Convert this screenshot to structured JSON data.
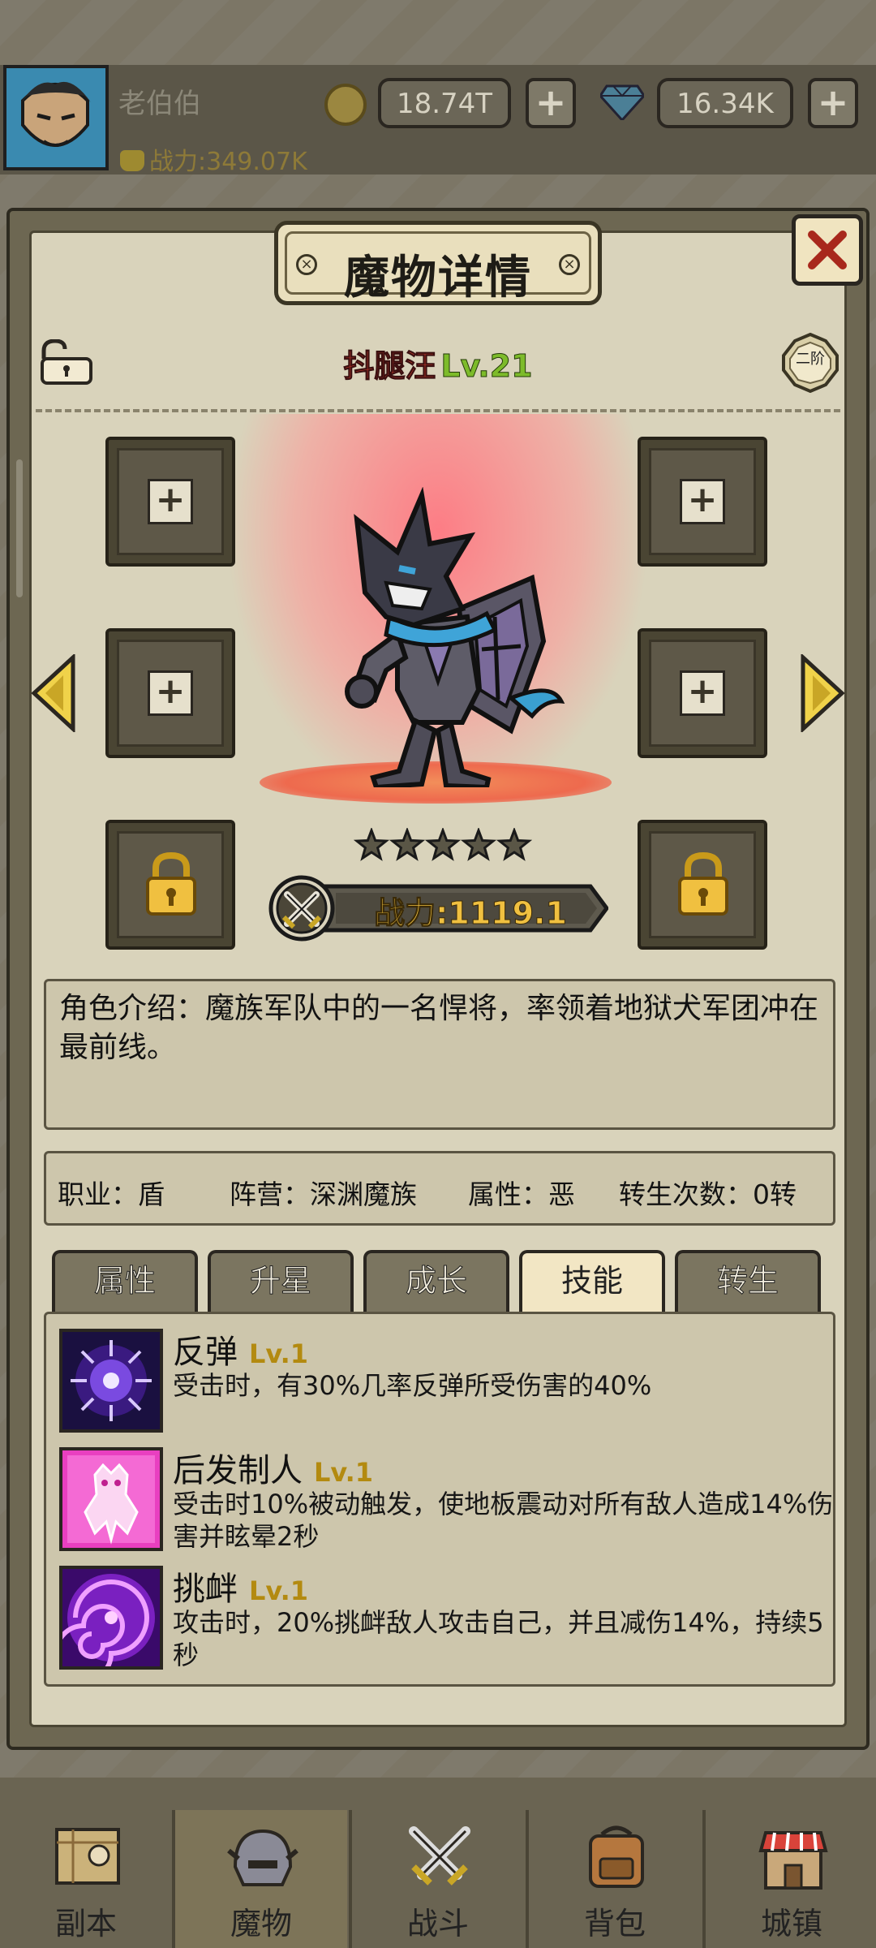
{
  "player": {
    "name": "老伯伯",
    "power": "战力:349.07K"
  },
  "currency": {
    "gold": "18.74T",
    "diamonds": "16.34K"
  },
  "dialog": {
    "title": "魔物详情"
  },
  "monster": {
    "name": "抖腿汪",
    "level": "Lv.21",
    "grade": "二阶",
    "stars": 5,
    "power": "战力:1119.1"
  },
  "description": "角色介绍：魔族军队中的一名悍将，率领着地狱犬军团冲在最前线。",
  "info": {
    "job": "职业：盾",
    "camp": "阵营：深渊魔族",
    "attribute": "属性：恶",
    "rebirth": "转生次数：0转"
  },
  "tabs": [
    "属性",
    "升星",
    "成长",
    "技能",
    "转生"
  ],
  "active_tab": "技能",
  "skills": [
    {
      "name": "反弹",
      "level": "Lv.1",
      "desc": "受击时，有30%几率反弹所受伤害的40%",
      "icon": "spiked-orb-icon",
      "color": "#5b2fb0"
    },
    {
      "name": "后发制人",
      "level": "Lv.1",
      "desc": "受击时10%被动触发，使地板震动对所有敌人造成14%伤害并眩晕2秒",
      "icon": "pink-figure-icon",
      "color": "#f049c8"
    },
    {
      "name": "挑衅",
      "level": "Lv.1",
      "desc": "攻击时，20%挑衅敌人攻击自己，并且减伤14%，持续5秒",
      "icon": "vortex-icon",
      "color": "#9a2fd8"
    }
  ],
  "nav": [
    "副本",
    "魔物",
    "战斗",
    "背包",
    "城镇"
  ],
  "nav_active": "魔物",
  "colors": {
    "name_red": "#c0392b",
    "level_green": "#7dbb2a",
    "power_gold": "#f0c040",
    "spotlight": "#ff7882"
  }
}
